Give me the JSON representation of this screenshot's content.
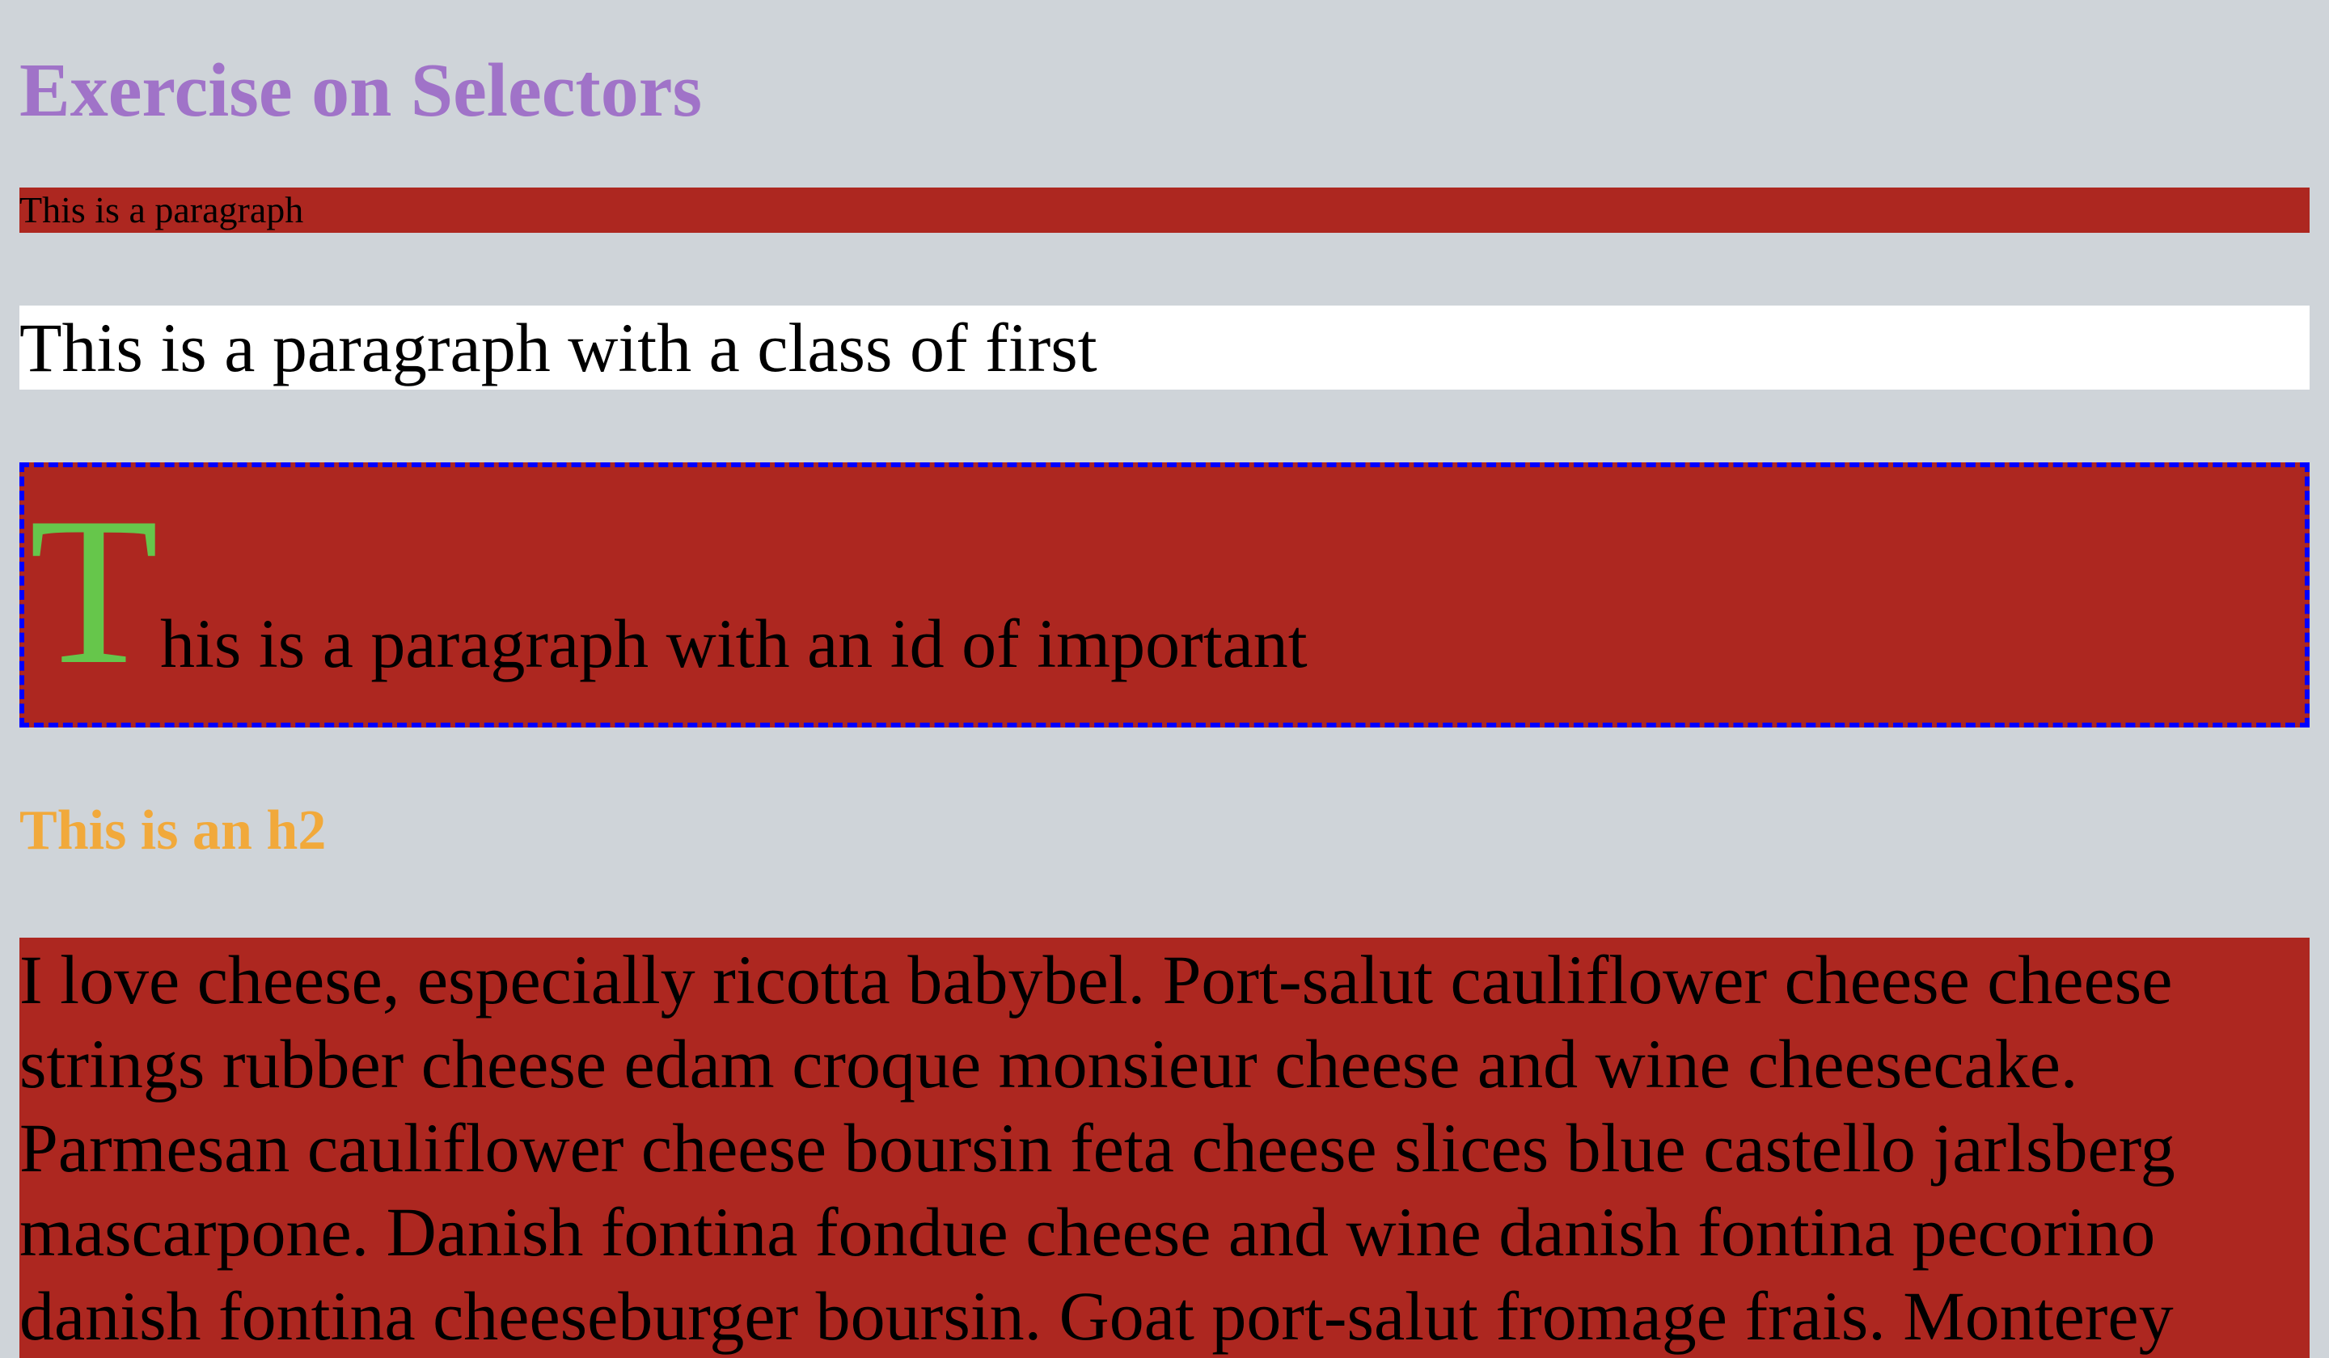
{
  "page": {
    "title": "Exercise on Selectors",
    "paragraph_plain": "This is a paragraph",
    "paragraph_first": "This is a paragraph with a class of first",
    "paragraph_important": {
      "first_letter": "T",
      "rest": "his is a paragraph with an id of important"
    },
    "heading_h2": "This is an h2",
    "paragraph_cheese": "I love cheese, especially ricotta babybel. Port-salut cauliflower cheese cheese strings rubber cheese edam croque monsieur cheese and wine cheesecake. Parmesan cauliflower cheese boursin feta cheese slices blue castello jarlsberg mascarpone. Danish fontina fondue cheese and wine danish fontina pecorino danish fontina cheeseburger boursin. Goat port-salut fromage frais. Monterey"
  },
  "colors": {
    "background": "#cfd4d9",
    "title": "#a073c8",
    "red_block": "#ad2720",
    "first_block": "#ffffff",
    "drop_cap": "#66c64b",
    "dashed_border": "#0000ff",
    "h2": "#f1a93b"
  }
}
